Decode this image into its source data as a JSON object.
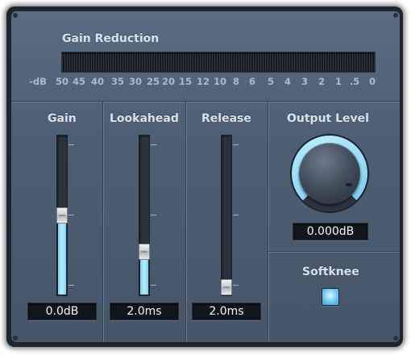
{
  "gain_reduction": {
    "label": "Gain Reduction",
    "scale": [
      "-dB",
      "50",
      "45",
      "40",
      "35",
      "30",
      "25",
      "20",
      "15",
      "12",
      "10",
      "8",
      "6",
      "5",
      "4",
      "3",
      "2",
      "1",
      ".5",
      "0"
    ]
  },
  "controls": {
    "gain": {
      "label": "Gain",
      "value": "0.0dB",
      "level": 0.5
    },
    "lookahead": {
      "label": "Lookahead",
      "value": "2.0ms",
      "level": 0.25
    },
    "release": {
      "label": "Release",
      "value": "2.0ms",
      "level": 0.0
    },
    "output_level": {
      "label": "Output Level",
      "value": "0.000dB"
    },
    "softknee": {
      "label": "Softknee",
      "state": "on"
    }
  },
  "colors": {
    "panel": "#4e6075",
    "accent": "#8ed8f6",
    "readout_bg": "#11161c"
  }
}
